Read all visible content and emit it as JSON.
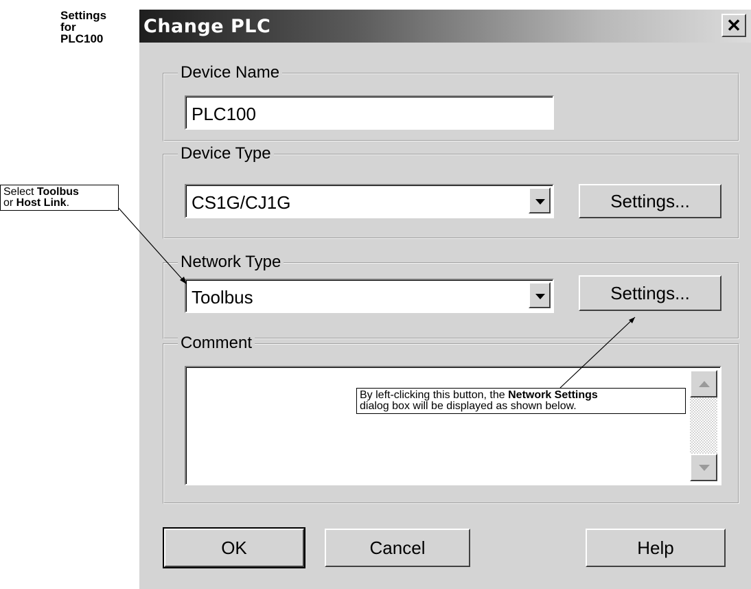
{
  "side_heading": "Settings\nfor\nPLC100",
  "callouts": {
    "left": {
      "part1": "Select ",
      "bold1": "Toolbus",
      "part2": "or ",
      "bold2": "Host Link",
      "part3": "."
    },
    "right": {
      "part1": "By left-clicking this button, the ",
      "bold1": "Network Settings",
      "part2": "dialog box will be displayed as shown below."
    }
  },
  "dialog": {
    "title": "Change PLC",
    "close_glyph": "✕",
    "device_name": {
      "label": "Device Name",
      "value": "PLC100"
    },
    "device_type": {
      "label": "Device Type",
      "selected": "CS1G/CJ1G",
      "settings_label": "Settings..."
    },
    "network_type": {
      "label": "Network Type",
      "selected": "Toolbus",
      "settings_label": "Settings..."
    },
    "comment": {
      "label": "Comment",
      "value": ""
    },
    "buttons": {
      "ok": "OK",
      "cancel": "Cancel",
      "help": "Help"
    }
  }
}
